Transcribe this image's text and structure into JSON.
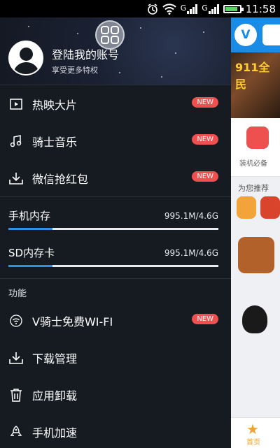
{
  "status_bar": {
    "time": "11:58",
    "network_type_1": "G",
    "network_type_2": "G",
    "icons": [
      "alarm-icon",
      "wifi-icon",
      "signal-icon",
      "signal-icon",
      "battery-icon"
    ]
  },
  "profile": {
    "title": "登陆我的账号",
    "subtitle": "享受更多特权"
  },
  "menu_items": [
    {
      "label": "热映大片",
      "icon": "play-icon",
      "badge": "NEW"
    },
    {
      "label": "骑士音乐",
      "icon": "music-note-icon",
      "badge": "NEW"
    },
    {
      "label": "微信抢红包",
      "icon": "download-icon",
      "badge": "NEW"
    }
  ],
  "storage": [
    {
      "label": "手机内存",
      "value": "995.1M/4.6G",
      "used_percent": 21
    },
    {
      "label": "SD内存卡",
      "value": "995.1M/4.6G",
      "used_percent": 21
    }
  ],
  "functions_section": {
    "title": "功能",
    "items": [
      {
        "label": "V骑士免费WI-FI",
        "icon": "wifi-circle-icon",
        "badge": "NEW"
      },
      {
        "label": "下载管理",
        "icon": "download-icon"
      },
      {
        "label": "应用卸载",
        "icon": "trash-icon"
      },
      {
        "label": "手机加速",
        "icon": "rocket-icon"
      }
    ]
  },
  "background_app": {
    "banner_text": "911全民",
    "tile_label": "装机必备",
    "recommend_text": "为您推荐",
    "nav_home": "首页"
  },
  "colors": {
    "drawer_bg": "#161a21",
    "badge": "#ee5050",
    "progress": "#2f8fe8",
    "app_blue": "#1b8ce6"
  }
}
